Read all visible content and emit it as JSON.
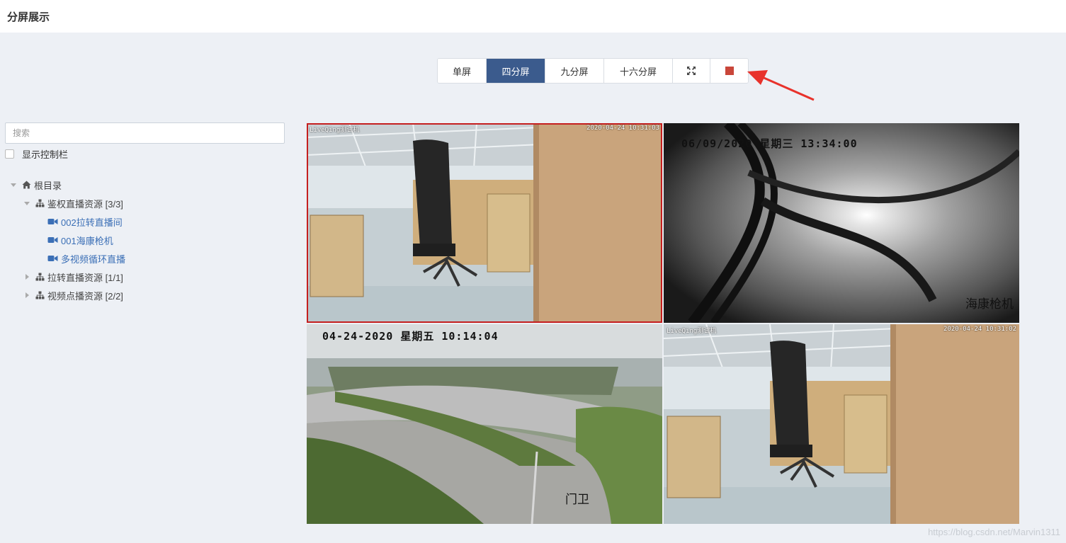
{
  "header": {
    "title": "分屏展示"
  },
  "toolbar": {
    "buttons": [
      {
        "label": "单屏",
        "active": false
      },
      {
        "label": "四分屏",
        "active": true
      },
      {
        "label": "九分屏",
        "active": false
      },
      {
        "label": "十六分屏",
        "active": false
      }
    ],
    "fullscreen_icon": "fullscreen-icon",
    "stop_icon": "stop-icon",
    "colors": {
      "active": "#3b5b8d",
      "stop": "#c9463a",
      "arrow": "#e8322b"
    }
  },
  "sidebar": {
    "search": {
      "placeholder": "搜索",
      "value": ""
    },
    "show_controls": {
      "label": "显示控制栏",
      "checked": false
    },
    "tree": {
      "root": {
        "label": "根目录",
        "icon": "home-icon",
        "expanded": true
      },
      "groups": [
        {
          "label": "鉴权直播资源 [3/3]",
          "icon": "sitemap-icon",
          "expanded": true,
          "items": [
            {
              "label": "002拉转直播间",
              "icon": "video-camera-icon"
            },
            {
              "label": "001海康枪机",
              "icon": "video-camera-icon"
            },
            {
              "label": "多视频循环直播",
              "icon": "video-camera-icon"
            }
          ]
        },
        {
          "label": "拉转直播资源 [1/1]",
          "icon": "sitemap-icon",
          "expanded": false,
          "items": []
        },
        {
          "label": "视频点播资源 [2/2]",
          "icon": "sitemap-icon",
          "expanded": false,
          "items": []
        }
      ]
    }
  },
  "screens": [
    {
      "osd_left": "LiveQing测试机",
      "osd_right": "2020-04-24 10:31:03",
      "selected": true
    },
    {
      "osd_time": "06/09/2020 星期三 13:34:00",
      "camera_name": "海康枪机",
      "selected": false
    },
    {
      "osd_time": "04-24-2020 星期五 10:14:04",
      "camera_name": "门卫",
      "selected": false
    },
    {
      "osd_left": "LiveQing测试机",
      "osd_right": "2020-04-24 10:31:02",
      "selected": false
    }
  ],
  "watermark": "https://blog.csdn.net/Marvin1311"
}
